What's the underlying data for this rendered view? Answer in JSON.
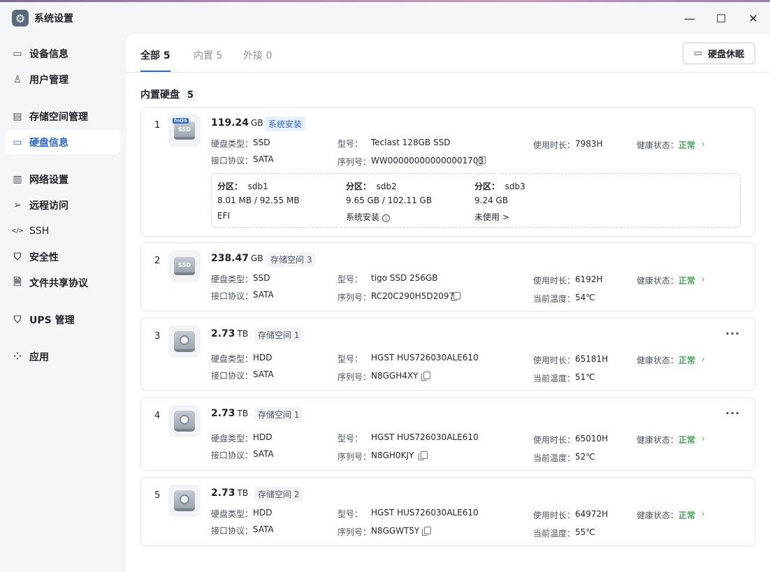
{
  "window": {
    "title": "系统设置"
  },
  "sidebar": {
    "items": [
      {
        "label": "设备信息",
        "icon": "device-icon"
      },
      {
        "label": "用户管理",
        "icon": "user-icon"
      },
      {
        "label": "存储空间管理",
        "icon": "storage-icon"
      },
      {
        "label": "硬盘信息",
        "icon": "disk-icon",
        "active": true
      },
      {
        "label": "网络设置",
        "icon": "network-icon"
      },
      {
        "label": "远程访问",
        "icon": "remote-icon"
      },
      {
        "label": "SSH",
        "icon": "ssh-icon"
      },
      {
        "label": "安全性",
        "icon": "shield-icon"
      },
      {
        "label": "文件共享协议",
        "icon": "file-share-icon"
      },
      {
        "label": "UPS 管理",
        "icon": "ups-icon"
      },
      {
        "label": "应用",
        "icon": "apps-icon"
      }
    ]
  },
  "tabs": [
    {
      "label": "全部 5",
      "active": true
    },
    {
      "label": "内置 5"
    },
    {
      "label": "外接 0"
    }
  ],
  "sleep_button": "硬盘休眠",
  "section": {
    "title": "内置硬盘",
    "count": "5"
  },
  "field_labels": {
    "type": "硬盘类型：",
    "interface": "接口协议：",
    "model": "型号：",
    "serial": "序列号：",
    "hours": "使用时长：",
    "health": "健康状态：",
    "temp": "当前温度："
  },
  "disks": [
    {
      "index": "1",
      "size": "119.24",
      "unit": "GB",
      "pool": "系统安装",
      "icon_badge": "fnOS",
      "icon_text": "SSD",
      "type": "SSD",
      "interface": "SATA",
      "model": "Teclast 128GB SSD",
      "serial": "WW000000000000001703",
      "hours": "7983H",
      "health": "正常",
      "partitions": [
        {
          "label": "分区：",
          "name": "sdb1",
          "usage": "8.01 MB / 92.55 MB",
          "desc": "EFI"
        },
        {
          "label": "分区：",
          "name": "sdb2",
          "usage": "9.65 GB / 102.11 GB",
          "desc": "系统安装"
        },
        {
          "label": "分区：",
          "name": "sdb3",
          "usage": "9.24 GB",
          "desc": "未使用 >"
        }
      ]
    },
    {
      "index": "2",
      "size": "238.47",
      "unit": "GB",
      "pool": "存储空间 3",
      "icon_text": "SSD",
      "type": "SSD",
      "interface": "SATA",
      "model": "tigo SSD 256GB",
      "serial": "RC20C290H5D2097",
      "hours": "6192H",
      "health": "正常",
      "temp": "54℃"
    },
    {
      "index": "3",
      "size": "2.73",
      "unit": "TB",
      "pool": "存储空间 1",
      "type": "HDD",
      "interface": "SATA",
      "model": "HGST HUS726030ALE610",
      "serial": "N8GGH4XY",
      "hours": "65181H",
      "health": "正常",
      "temp": "51℃"
    },
    {
      "index": "4",
      "size": "2.73",
      "unit": "TB",
      "pool": "存储空间 1",
      "type": "HDD",
      "interface": "SATA",
      "model": "HGST HUS726030ALE610",
      "serial": "N8GH0KJY",
      "hours": "65010H",
      "health": "正常",
      "temp": "52℃"
    },
    {
      "index": "5",
      "size": "2.73",
      "unit": "TB",
      "pool": "存储空间 2",
      "type": "HDD",
      "interface": "SATA",
      "model": "HGST HUS726030ALE610",
      "serial": "N8GGWT5Y",
      "hours": "64972H",
      "health": "正常",
      "temp": "55℃"
    }
  ],
  "colors": {
    "accent": "#2a66d6",
    "healthy": "#4aa65a"
  }
}
